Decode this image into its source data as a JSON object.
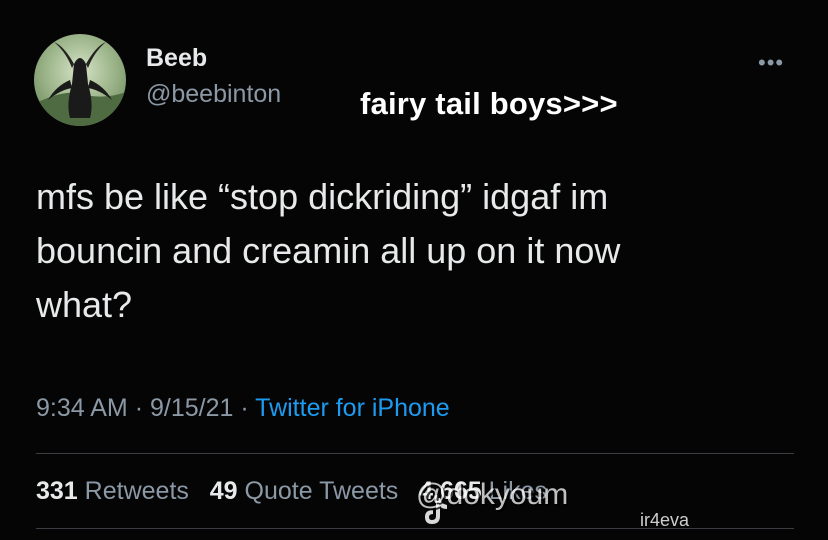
{
  "tweet": {
    "display_name": "Beeb",
    "handle": "@beebinton",
    "more_icon": "more-horizontal-icon",
    "text_lines": [
      "mfs be like “stop dickriding” idgaf im",
      "bouncin and creamin all up on it now",
      "what?"
    ],
    "time": "9:34 AM",
    "date": "9/15/21",
    "source": "Twitter for iPhone",
    "stats": {
      "retweets_count": "331",
      "retweets_label": "Retweets",
      "quotes_count": "49",
      "quotes_label": "Quote Tweets",
      "likes_count": "4,665",
      "likes_label": "Likes"
    }
  },
  "overlay": {
    "caption": "fairy tail boys>>>",
    "watermark": "@dokyoum",
    "watermark_secondary": "ir4eva"
  },
  "colors": {
    "background": "#050505",
    "text": "#e7e9ea",
    "secondary": "#8b98a5",
    "link": "#1d9bf0"
  }
}
